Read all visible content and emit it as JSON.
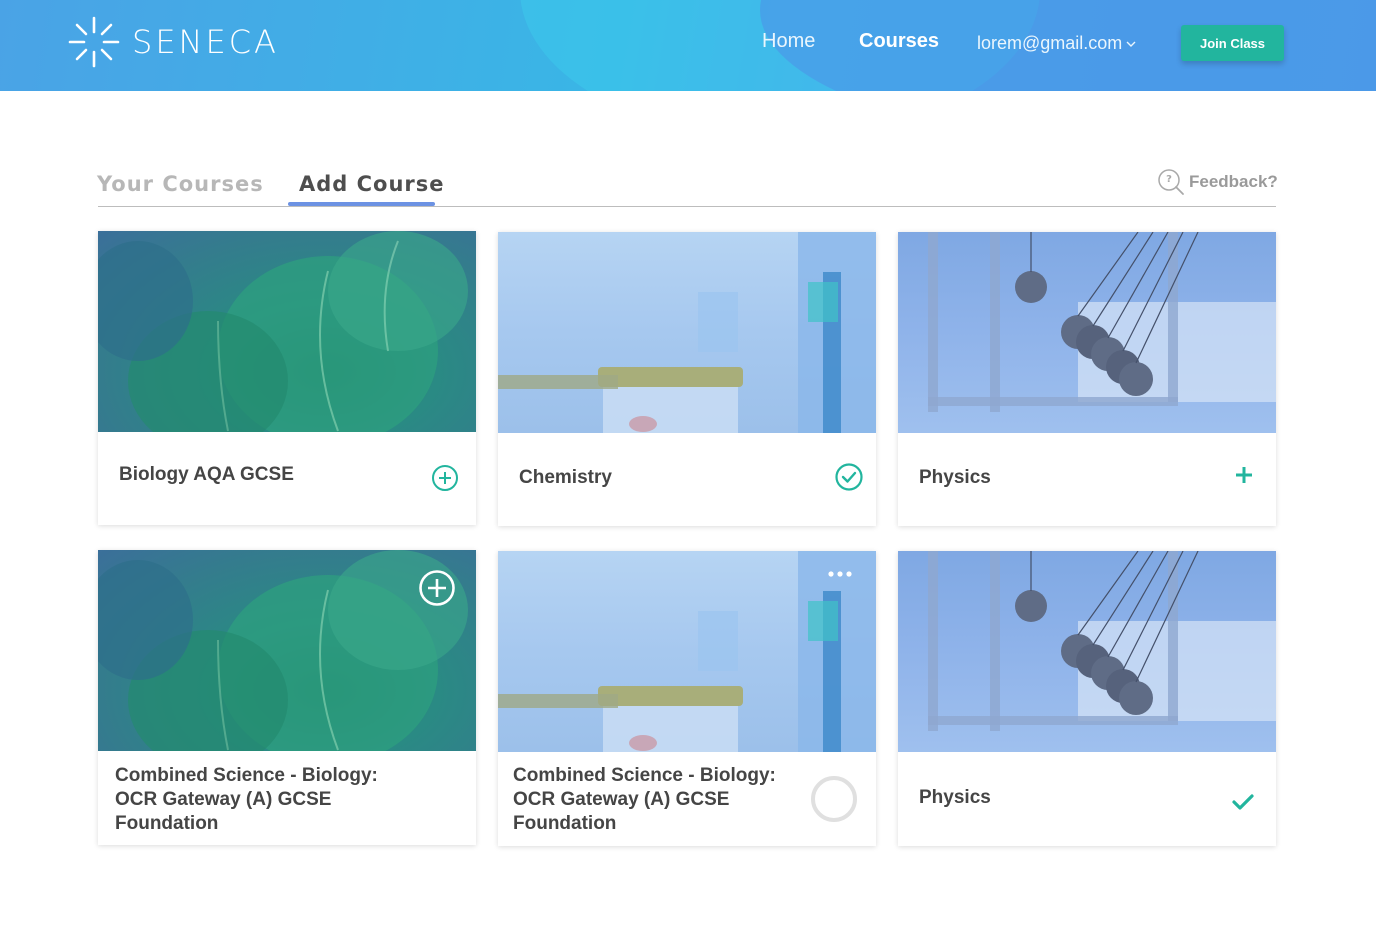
{
  "header": {
    "brand": "SENECA",
    "nav": {
      "home": "Home",
      "courses": "Courses",
      "email": "lorem@gmail.com"
    },
    "join_button": "Join Class"
  },
  "tabs": {
    "your_courses": "Your Courses",
    "add_course": "Add Course"
  },
  "feedback_label": "Feedback?",
  "cards": [
    {
      "title": "Biology AQA GCSE",
      "image": "plant-leaves",
      "action": "add-circle-icon"
    },
    {
      "title": "Chemistry",
      "image": "lab-jar",
      "action": "check-circle-icon"
    },
    {
      "title": "Physics",
      "image": "newtons-cradle",
      "action": "plus-icon"
    },
    {
      "title_lines": [
        "Combined Science - Biology:",
        "OCR Gateway (A) GCSE",
        "Foundation"
      ],
      "image": "plant-leaves",
      "action": "add-circle-overlay-icon"
    },
    {
      "title_lines": [
        "Combined Science - Biology:",
        "OCR Gateway (A) GCSE",
        "Foundation"
      ],
      "image": "lab-jar",
      "action": "loading-ring-icon",
      "menu": "more-dots-icon"
    },
    {
      "title": "Physics",
      "image": "newtons-cradle",
      "action": "check-icon"
    }
  ],
  "colors": {
    "accent": "#22b59e",
    "tab_underline": "#6c92e3",
    "header": "#45a8e8"
  }
}
